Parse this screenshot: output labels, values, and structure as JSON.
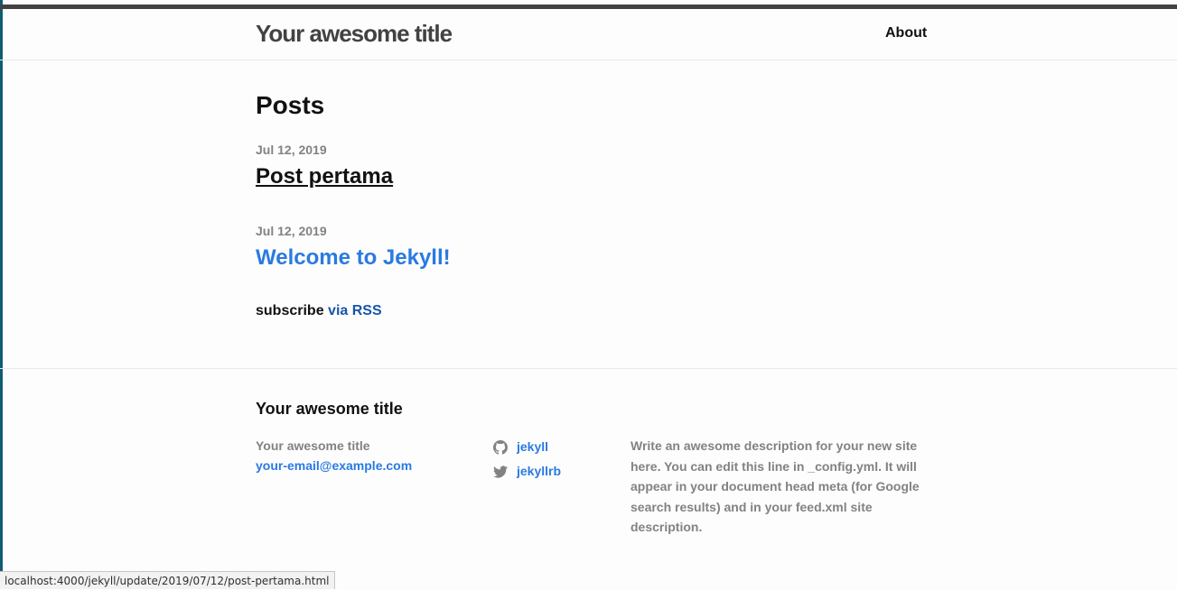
{
  "header": {
    "site_title": "Your awesome title",
    "nav": {
      "about": "About"
    }
  },
  "main": {
    "heading": "Posts",
    "posts": [
      {
        "date": "Jul 12, 2019",
        "title": "Post pertama"
      },
      {
        "date": "Jul 12, 2019",
        "title": "Welcome to Jekyll!"
      }
    ],
    "subscribe": {
      "label": "subscribe",
      "rss_link": "via RSS"
    }
  },
  "footer": {
    "heading": "Your awesome title",
    "name": "Your awesome title",
    "email": "your-email@example.com",
    "social": [
      {
        "icon": "github-icon",
        "username": "jekyll"
      },
      {
        "icon": "twitter-icon",
        "username": "jekyllrb"
      }
    ],
    "description": "Write an awesome description for your new site here. You can edit this line in _config.yml. It will appear in your document head meta (for Google search results) and in your feed.xml site description."
  },
  "status_bar": {
    "url": "localhost:4000/jekyll/update/2019/07/12/post-pertama.html"
  },
  "colors": {
    "link": "#2a7ae2",
    "meta_gray": "#828282",
    "title_gray": "#424242"
  }
}
